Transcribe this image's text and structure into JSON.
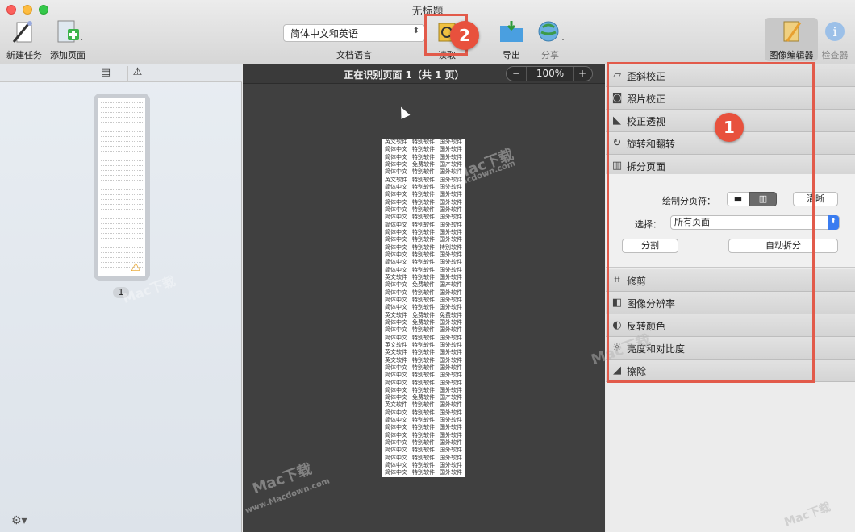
{
  "window": {
    "title": "无标题"
  },
  "toolbar": {
    "new_task": "新建任务",
    "add_page": "添加页面",
    "language": {
      "value": "简体中文和英语",
      "label": "文档语言"
    },
    "read": "读取",
    "export": "导出",
    "share": "分享",
    "image_editor": "图像编辑器",
    "inspector": "检查器"
  },
  "sidebar": {
    "page_number": "1"
  },
  "center": {
    "status": "正在识别页面 1（共 1 页）",
    "zoom": "100%"
  },
  "page_columns": [
    "英文软件",
    "特别软件",
    "国外软件"
  ],
  "page_rows": [
    [
      "英文软件",
      "特别软件",
      "国外软件"
    ],
    [
      "简体中文",
      "特别软件",
      "国外软件"
    ],
    [
      "简体中文",
      "特别软件",
      "国外软件"
    ],
    [
      "简体中文",
      "免费软件",
      "国产软件"
    ],
    [
      "简体中文",
      "特别软件",
      "国外软件"
    ],
    [
      "英文软件",
      "特别软件",
      "国外软件"
    ],
    [
      "简体中文",
      "特别软件",
      "国外软件"
    ],
    [
      "简体中文",
      "特别软件",
      "国外软件"
    ],
    [
      "简体中文",
      "特别软件",
      "国外软件"
    ],
    [
      "简体中文",
      "特别软件",
      "国外软件"
    ],
    [
      "简体中文",
      "特别软件",
      "国外软件"
    ],
    [
      "简体中文",
      "特别软件",
      "国外软件"
    ],
    [
      "简体中文",
      "特别软件",
      "国外软件"
    ],
    [
      "简体中文",
      "特别软件",
      "国外软件"
    ],
    [
      "简体中文",
      "特别软件",
      "特别软件"
    ],
    [
      "简体中文",
      "特别软件",
      "国外软件"
    ],
    [
      "简体中文",
      "特别软件",
      "国外软件"
    ],
    [
      "简体中文",
      "特别软件",
      "国外软件"
    ],
    [
      "英文软件",
      "特别软件",
      "国外软件"
    ],
    [
      "简体中文",
      "免费软件",
      "国产软件"
    ],
    [
      "简体中文",
      "特别软件",
      "国外软件"
    ],
    [
      "简体中文",
      "特别软件",
      "国外软件"
    ],
    [
      "简体中文",
      "特别软件",
      "国外软件"
    ],
    [
      "英文软件",
      "免费软件",
      "免费软件"
    ],
    [
      "简体中文",
      "免费软件",
      "国外软件"
    ],
    [
      "简体中文",
      "特别软件",
      "国外软件"
    ],
    [
      "简体中文",
      "特别软件",
      "国外软件"
    ],
    [
      "英文软件",
      "特别软件",
      "国外软件"
    ],
    [
      "英文软件",
      "特别软件",
      "国外软件"
    ],
    [
      "英文软件",
      "特别软件",
      "国外软件"
    ],
    [
      "简体中文",
      "特别软件",
      "国外软件"
    ],
    [
      "简体中文",
      "特别软件",
      "国外软件"
    ],
    [
      "简体中文",
      "特别软件",
      "国外软件"
    ],
    [
      "简体中文",
      "特别软件",
      "国外软件"
    ],
    [
      "简体中文",
      "免费软件",
      "国产软件"
    ],
    [
      "英文软件",
      "特别软件",
      "国外软件"
    ],
    [
      "简体中文",
      "特别软件",
      "国外软件"
    ],
    [
      "简体中文",
      "特别软件",
      "国外软件"
    ],
    [
      "简体中文",
      "特别软件",
      "国外软件"
    ],
    [
      "简体中文",
      "特别软件",
      "国外软件"
    ],
    [
      "简体中文",
      "特别软件",
      "国外软件"
    ],
    [
      "简体中文",
      "特别软件",
      "国外软件"
    ],
    [
      "简体中文",
      "特别软件",
      "国外软件"
    ],
    [
      "简体中文",
      "特别软件",
      "国外软件"
    ],
    [
      "简体中文",
      "特别软件",
      "国外软件"
    ]
  ],
  "image_editor": {
    "deskew": "歪斜校正",
    "photo_correct": "照片校正",
    "perspective": "校正透视",
    "rotate_flip": "旋转和翻转",
    "split_pages": "拆分页面",
    "draw_separator": "绘制分页符：",
    "clear": "清晰",
    "select_label": "选择：",
    "select_value": "所有页面",
    "split": "分割",
    "auto_split": "自动拆分",
    "crop": "修剪",
    "resolution": "图像分辨率",
    "invert": "反转颜色",
    "brightness": "亮度和对比度",
    "erase": "擦除"
  },
  "annotations": {
    "badge1": "1",
    "badge2": "2"
  },
  "watermarks": [
    "Mac下载",
    "www.Macdown.com"
  ],
  "colors": {
    "highlight": "#e25a4a",
    "badge": "#e8513d",
    "canvas": "#404040"
  }
}
